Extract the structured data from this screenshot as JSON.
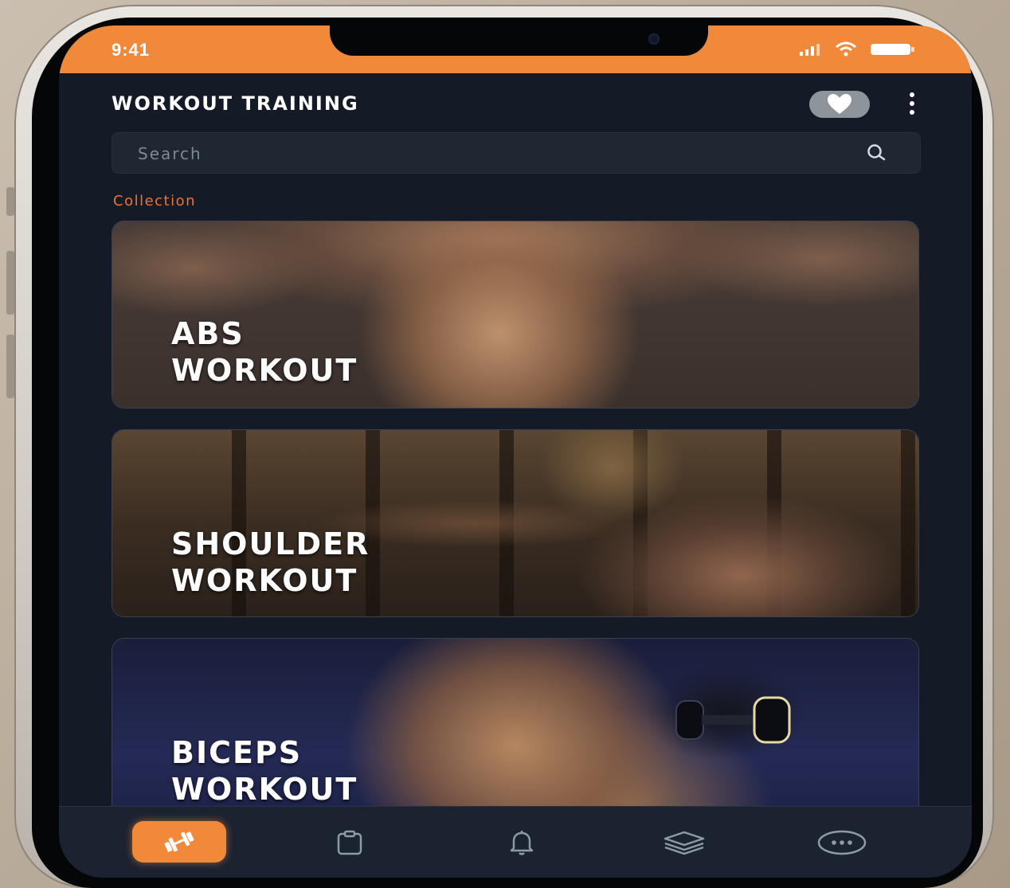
{
  "status_bar": {
    "time": "9:41",
    "icons": [
      "cellular-signal-icon",
      "wifi-icon",
      "battery-icon"
    ]
  },
  "header": {
    "title": "WORKOUT TRAINING",
    "favorite_icon": "heart-icon",
    "menu_icon": "more-vertical-icon"
  },
  "search": {
    "placeholder": "Search",
    "icon": "search-icon"
  },
  "section": {
    "label": "Collection"
  },
  "cards": [
    {
      "line1": "ABS",
      "line2": "WORKOUT"
    },
    {
      "line1": "SHOULDER",
      "line2": "WORKOUT"
    },
    {
      "line1": "BICEPS",
      "line2": "WORKOUT"
    }
  ],
  "bottom_nav": {
    "items": [
      {
        "icon": "dumbbell-icon",
        "active": true
      },
      {
        "icon": "clipboard-icon",
        "active": false
      },
      {
        "icon": "bell-icon",
        "active": false
      },
      {
        "icon": "layers-icon",
        "active": false
      },
      {
        "icon": "chat-dots-icon",
        "active": false
      }
    ]
  },
  "colors": {
    "accent": "#f08a3a",
    "background": "#141a26",
    "search_bg": "#1f2733",
    "section_label": "#e8743a"
  }
}
